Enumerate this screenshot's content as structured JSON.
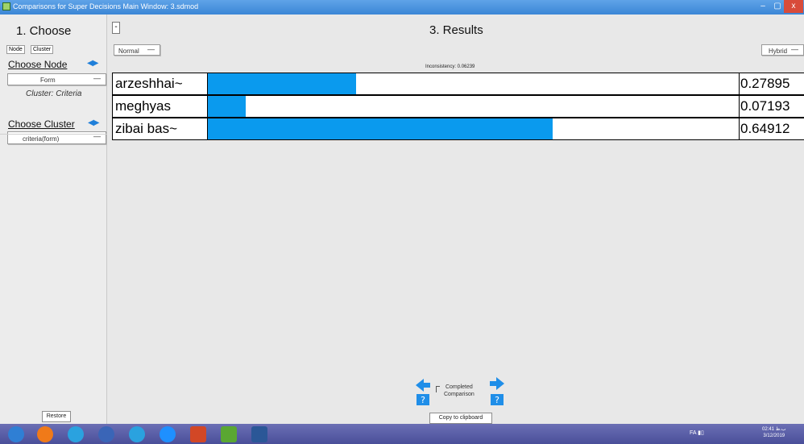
{
  "window": {
    "title": "Comparisons for Super Decisions Main Window: 3.sdmod",
    "min_glyph": "–",
    "max_glyph": "▢",
    "close_glyph": "x"
  },
  "left": {
    "heading": "1. Choose",
    "tabs": [
      "Node",
      "Cluster"
    ],
    "choose_node_label": "Choose Node",
    "node_dropdown": "Form",
    "cluster_caption": "Cluster: Criteria",
    "choose_cluster_label": "Choose Cluster",
    "cluster_dropdown": "criteria(form)",
    "restore_label": "Restore"
  },
  "results": {
    "collapse_glyph": "-",
    "title": "3. Results",
    "mode_left": "Normal",
    "mode_right": "Hybrid",
    "inconsistency": "Inconsistency: 0.06239",
    "rows": [
      {
        "name": "arzeshhai~",
        "value": "0.27895",
        "fraction": 0.27895
      },
      {
        "name": "meghyas",
        "value": "0.07193",
        "fraction": 0.07193
      },
      {
        "name": "zibai bas~",
        "value": "0.64912",
        "fraction": 0.64912
      }
    ],
    "completed_label_1": "Completed",
    "completed_label_2": "Comparison",
    "copy_label": "Copy to clipboard"
  },
  "taskbar": {
    "lang": "FA",
    "clock_time": "02:41 ب.ظ",
    "clock_date": "3/12/2019"
  },
  "colors": {
    "bar": "#0a9aee",
    "titlebar": "#3b86d6",
    "taskbar": "#4a4f99"
  }
}
